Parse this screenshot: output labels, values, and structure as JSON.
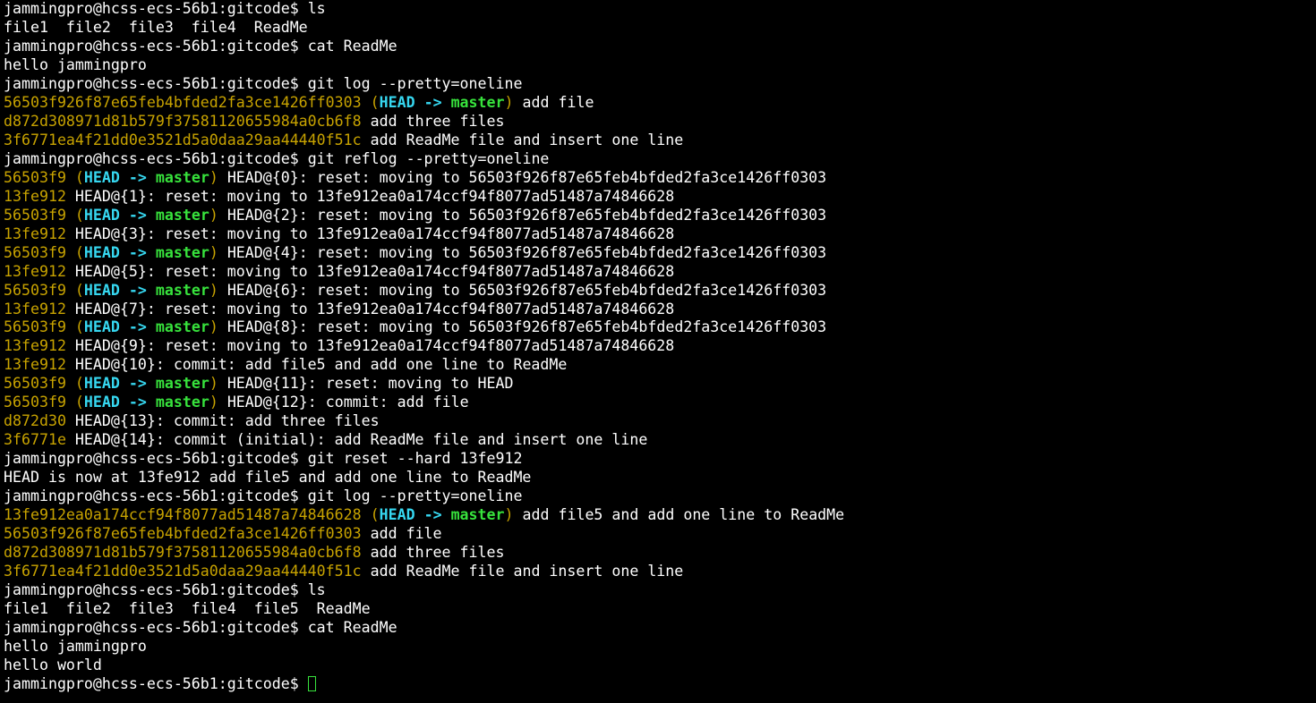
{
  "terminal": {
    "lines": [
      {
        "type": "cmd",
        "prompt": "jammingpro@hcss-ecs-56b1:gitcode$",
        "command": "ls"
      },
      {
        "type": "out",
        "text": "file1  file2  file3  file4  ReadMe"
      },
      {
        "type": "cmd",
        "prompt": "jammingpro@hcss-ecs-56b1:gitcode$",
        "command": "cat ReadMe"
      },
      {
        "type": "out",
        "text": "hello jammingpro"
      },
      {
        "type": "cmd",
        "prompt": "jammingpro@hcss-ecs-56b1:gitcode$",
        "command": "git log --pretty=oneline"
      },
      {
        "type": "commit",
        "hash": "56503f926f87e65feb4bfded2fa3ce1426ff0303",
        "head": true,
        "rest": " add file"
      },
      {
        "type": "commit",
        "hash": "d872d308971d81b579f37581120655984a0cb6f8",
        "head": false,
        "rest": " add three files"
      },
      {
        "type": "commit",
        "hash": "3f6771ea4f21dd0e3521d5a0daa29aa44440f51c",
        "head": false,
        "rest": " add ReadMe file and insert one line"
      },
      {
        "type": "cmd",
        "prompt": "jammingpro@hcss-ecs-56b1:gitcode$",
        "command": "git reflog --pretty=oneline"
      },
      {
        "type": "commit",
        "hash": "56503f9",
        "head": true,
        "rest": " HEAD@{0}: reset: moving to 56503f926f87e65feb4bfded2fa3ce1426ff0303"
      },
      {
        "type": "commit",
        "hash": "13fe912",
        "head": false,
        "rest": " HEAD@{1}: reset: moving to 13fe912ea0a174ccf94f8077ad51487a74846628"
      },
      {
        "type": "commit",
        "hash": "56503f9",
        "head": true,
        "rest": " HEAD@{2}: reset: moving to 56503f926f87e65feb4bfded2fa3ce1426ff0303"
      },
      {
        "type": "commit",
        "hash": "13fe912",
        "head": false,
        "rest": " HEAD@{3}: reset: moving to 13fe912ea0a174ccf94f8077ad51487a74846628"
      },
      {
        "type": "commit",
        "hash": "56503f9",
        "head": true,
        "rest": " HEAD@{4}: reset: moving to 56503f926f87e65feb4bfded2fa3ce1426ff0303"
      },
      {
        "type": "commit",
        "hash": "13fe912",
        "head": false,
        "rest": " HEAD@{5}: reset: moving to 13fe912ea0a174ccf94f8077ad51487a74846628"
      },
      {
        "type": "commit",
        "hash": "56503f9",
        "head": true,
        "rest": " HEAD@{6}: reset: moving to 56503f926f87e65feb4bfded2fa3ce1426ff0303"
      },
      {
        "type": "commit",
        "hash": "13fe912",
        "head": false,
        "rest": " HEAD@{7}: reset: moving to 13fe912ea0a174ccf94f8077ad51487a74846628"
      },
      {
        "type": "commit",
        "hash": "56503f9",
        "head": true,
        "rest": " HEAD@{8}: reset: moving to 56503f926f87e65feb4bfded2fa3ce1426ff0303"
      },
      {
        "type": "commit",
        "hash": "13fe912",
        "head": false,
        "rest": " HEAD@{9}: reset: moving to 13fe912ea0a174ccf94f8077ad51487a74846628"
      },
      {
        "type": "commit",
        "hash": "13fe912",
        "head": false,
        "rest": " HEAD@{10}: commit: add file5 and add one line to ReadMe"
      },
      {
        "type": "commit",
        "hash": "56503f9",
        "head": true,
        "rest": " HEAD@{11}: reset: moving to HEAD"
      },
      {
        "type": "commit",
        "hash": "56503f9",
        "head": true,
        "rest": " HEAD@{12}: commit: add file"
      },
      {
        "type": "commit",
        "hash": "d872d30",
        "head": false,
        "rest": " HEAD@{13}: commit: add three files"
      },
      {
        "type": "commit",
        "hash": "3f6771e",
        "head": false,
        "rest": " HEAD@{14}: commit (initial): add ReadMe file and insert one line"
      },
      {
        "type": "cmd",
        "prompt": "jammingpro@hcss-ecs-56b1:gitcode$",
        "command": "git reset --hard 13fe912"
      },
      {
        "type": "out",
        "text": "HEAD is now at 13fe912 add file5 and add one line to ReadMe"
      },
      {
        "type": "cmd",
        "prompt": "jammingpro@hcss-ecs-56b1:gitcode$",
        "command": "git log --pretty=oneline"
      },
      {
        "type": "commit",
        "hash": "13fe912ea0a174ccf94f8077ad51487a74846628",
        "head": true,
        "rest": " add file5 and add one line to ReadMe"
      },
      {
        "type": "commit",
        "hash": "56503f926f87e65feb4bfded2fa3ce1426ff0303",
        "head": false,
        "rest": " add file"
      },
      {
        "type": "commit",
        "hash": "d872d308971d81b579f37581120655984a0cb6f8",
        "head": false,
        "rest": " add three files"
      },
      {
        "type": "commit",
        "hash": "3f6771ea4f21dd0e3521d5a0daa29aa44440f51c",
        "head": false,
        "rest": " add ReadMe file and insert one line"
      },
      {
        "type": "cmd",
        "prompt": "jammingpro@hcss-ecs-56b1:gitcode$",
        "command": "ls"
      },
      {
        "type": "out",
        "text": "file1  file2  file3  file4  file5  ReadMe"
      },
      {
        "type": "cmd",
        "prompt": "jammingpro@hcss-ecs-56b1:gitcode$",
        "command": "cat ReadMe"
      },
      {
        "type": "out",
        "text": "hello jammingpro"
      },
      {
        "type": "out",
        "text": "hello world"
      },
      {
        "type": "prompt",
        "prompt": "jammingpro@hcss-ecs-56b1:gitcode$"
      }
    ],
    "head_label": "HEAD",
    "arrow": "->",
    "branch_label": "master"
  },
  "colors": {
    "background": "#000000",
    "text": "#ffffff",
    "hash": "#c8a300",
    "head": "#36d7f0",
    "branch": "#37e23c",
    "cursor": "#37e23c"
  }
}
